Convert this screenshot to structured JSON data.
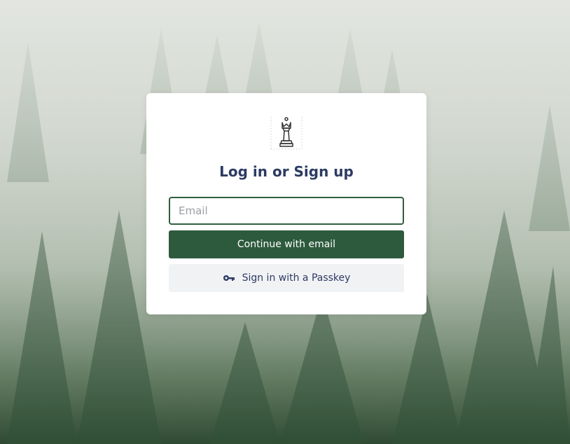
{
  "app": {
    "title": "Log in or Sign up"
  },
  "email": {
    "placeholder": "Email",
    "value": ""
  },
  "actions": {
    "continue_label": "Continue with email",
    "passkey_label": "Sign in with a Passkey"
  },
  "icons": {
    "logo": "chess-queen-logo-icon",
    "passkey": "key-icon"
  },
  "colors": {
    "primary": "#2d5a3d",
    "title": "#2d3b63",
    "input_border": "#2f5e3f"
  }
}
